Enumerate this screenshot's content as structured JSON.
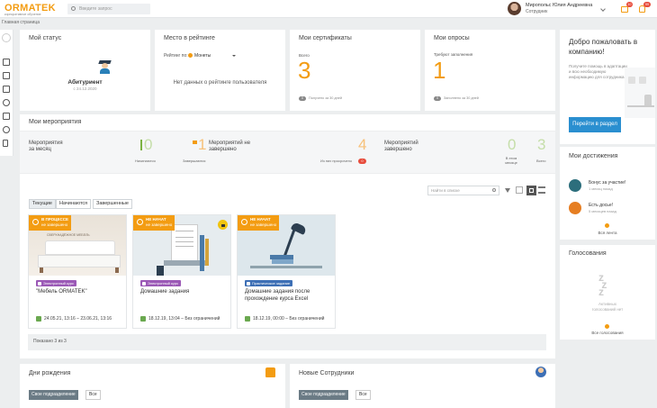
{
  "header": {
    "logo": "ORMATEK",
    "logo_sub": "корпоративное обучение",
    "search_placeholder": "Введите запрос",
    "user_name": "Миропольс Юлия Андреевна",
    "user_role": "Сотрудник",
    "badge1": "10",
    "badge2": "99"
  },
  "breadcrumb": "Главная страница",
  "status": {
    "title": "Мой статус",
    "value": "Абитуриент",
    "date": "с 24.12.2020"
  },
  "rating": {
    "title": "Место в рейтинге",
    "label": "Рейтинг по:",
    "select": "Монеты",
    "empty": "Нет данных о рейтинге пользователя"
  },
  "certs": {
    "title": "Мои сертификаты",
    "total_label": "Всего",
    "total": "3",
    "badge": "0",
    "note": "Получено за 30 дней"
  },
  "surveys": {
    "title": "Мои опросы",
    "label": "Требуют заполнения",
    "count": "1",
    "badge": "0",
    "note": "Заполнено за 30 дней"
  },
  "welcome": {
    "title": "Добро пожаловать в компанию!",
    "text": "Получите помощь в адаптации и всю необходимую информацию для сотрудника",
    "button": "Перейти в раздел"
  },
  "events": {
    "title": "Мои мероприятия",
    "month_label": "Мероприятия за месяц",
    "start_val": "0",
    "start_label": "Начинаются",
    "end_val": "1",
    "end_label": "Завершаются",
    "unfinished_label": "Мероприятий не завершено",
    "unfinished_val": "4",
    "overdue_label": "Из них просрочено",
    "overdue_val": "0",
    "finished_label": "Мероприятий завершено",
    "fin_month_val": "0",
    "fin_month_label": "В этом месяце",
    "fin_total_val": "3",
    "fin_total_label": "Всего",
    "search_placeholder": "Найти в списке",
    "tabs": [
      "Текущие",
      "Начинаются",
      "Завершенные"
    ],
    "shown": "Показано 3 из 3"
  },
  "courses": [
    {
      "status": "В ПРОЦЕССЕ",
      "status_sub": "не завершено",
      "type": "Электронный курс",
      "title": "\"Мебель ORMATEK\"",
      "dates": "24.05.21, 13:16 – 23.06.21, 13:16"
    },
    {
      "status": "НЕ НАЧАТ",
      "status_sub": "не завершено",
      "type": "Электронный курс",
      "title": "Домашние задания",
      "dates": "18.12.19, 13:04 – Без ограничений"
    },
    {
      "status": "НЕ НАЧАТ",
      "status_sub": "не завершено",
      "type": "Практическое задание",
      "title": "Домашние задания после прохождение курса Excel",
      "dates": "18.12.19, 00:00 – Без ограничений"
    }
  ],
  "course1_img_text": "СВЕРХНАДЁЖНОЕ МЕБЕЛЬ",
  "achievements": {
    "title": "Мои достижения",
    "items": [
      {
        "name": "Бонус за участие!",
        "sub": "1 месяц назад"
      },
      {
        "name": "Есть досье!",
        "sub": "5 месяцев назад"
      }
    ],
    "link": "Вся лента"
  },
  "votes": {
    "title": "Голосования",
    "empty": "Активных голосований нет",
    "link": "Все голосования"
  },
  "birthdays": {
    "title": "Дни рождения",
    "tab1": "Свое подразделение",
    "tab2": "Все"
  },
  "new_staff": {
    "title": "Новые Сотрудники",
    "tab1": "Свое подразделение",
    "tab2": "Все"
  },
  "colors": {
    "accent": "#f39c12",
    "blue": "#2a8fd0",
    "purple": "#9b59b6",
    "green": "#7cb342",
    "red": "#e74c3c"
  }
}
